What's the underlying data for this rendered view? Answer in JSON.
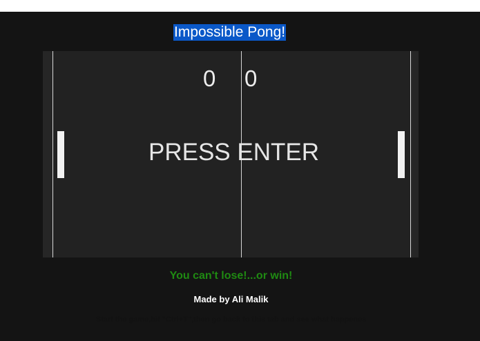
{
  "header": {
    "title": "Impossible Pong!"
  },
  "game": {
    "score_left": "0",
    "score_right": "0",
    "prompt": "PRESS ENTER"
  },
  "footer": {
    "tagline": "You can't lose!...or win!",
    "credit": "Made by Ali Malik",
    "hint": "Start the game,hit \"Ctrl+T\",then go back to this tab and see what happenes"
  },
  "colors": {
    "background": "#141414",
    "court": "#222222",
    "lines": "#d8d8d8",
    "title_highlight": "#0a58c8",
    "tagline": "#1f8a12"
  }
}
